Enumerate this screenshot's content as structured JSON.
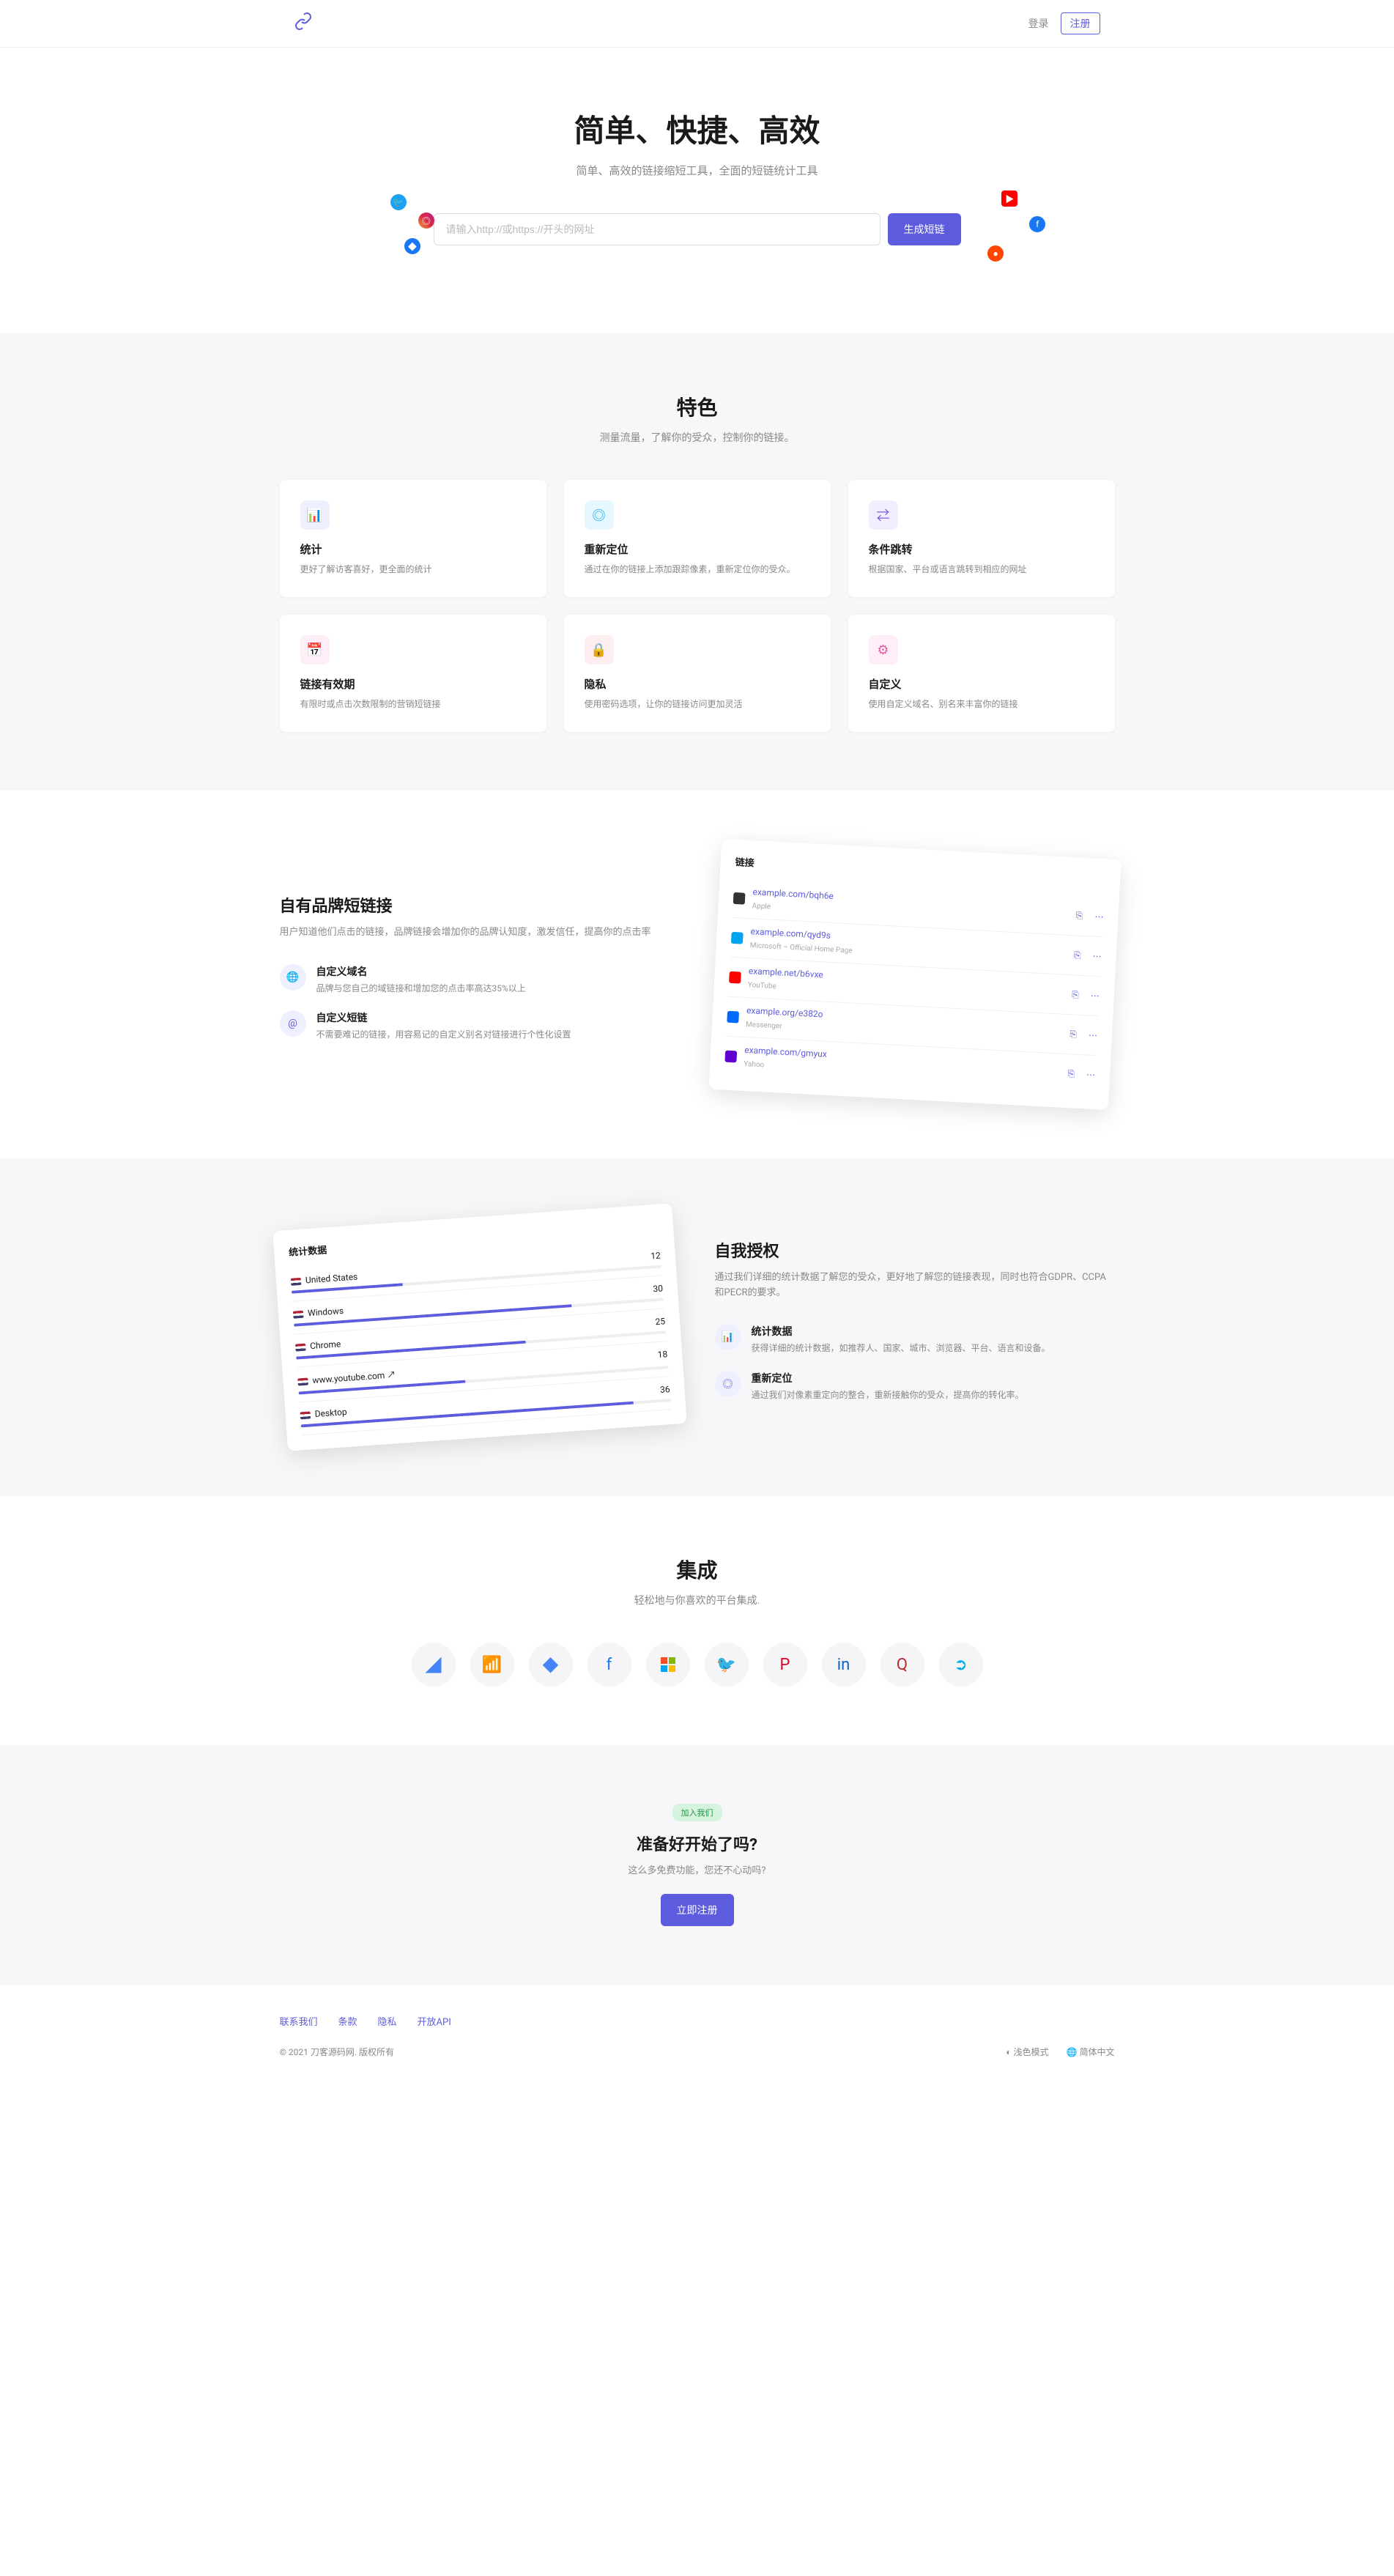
{
  "nav": {
    "login": "登录",
    "register": "注册"
  },
  "hero": {
    "title": "简单、快捷、高效",
    "subtitle": "简单、高效的链接缩短工具，全面的短链统计工具",
    "placeholder": "请输入http://或https://开头的网址",
    "button": "生成短链"
  },
  "features": {
    "title": "特色",
    "subtitle": "测量流量，了解你的受众，控制你的链接。",
    "items": [
      {
        "title": "统计",
        "desc": "更好了解访客喜好，更全面的统计"
      },
      {
        "title": "重新定位",
        "desc": "通过在你的链接上添加跟踪像素，重新定位你的受众。"
      },
      {
        "title": "条件跳转",
        "desc": "根据国家、平台或语言跳转到相应的网址"
      },
      {
        "title": "链接有效期",
        "desc": "有限时或点击次数限制的营销短链接"
      },
      {
        "title": "隐私",
        "desc": "使用密码选项，让你的链接访问更加灵活"
      },
      {
        "title": "自定义",
        "desc": "使用自定义域名、别名来丰富你的链接"
      }
    ]
  },
  "brand": {
    "title": "自有品牌短链接",
    "desc": "用户知道他们点击的链接，品牌链接会增加你的品牌认知度，激发信任，提高你的点击率",
    "items": [
      {
        "title": "自定义域名",
        "desc": "品牌与您自己的域链接和增加您的点击率高达35%以上"
      },
      {
        "title": "自定义短链",
        "desc": "不需要难记的链接，用容易记的自定义别名对链接进行个性化设置"
      }
    ],
    "mock": {
      "head": "链接",
      "rows": [
        {
          "link": "example.com/bqh6e",
          "sub": "Apple",
          "color": "#333"
        },
        {
          "link": "example.com/qyd9s",
          "sub": "Microsoft – Official Home Page",
          "color": "#00A4EF"
        },
        {
          "link": "example.net/b6vxe",
          "sub": "YouTube",
          "color": "#FF0000"
        },
        {
          "link": "example.org/e382o",
          "sub": "Messenger",
          "color": "#006AFF"
        },
        {
          "link": "example.com/gmyux",
          "sub": "Yahoo",
          "color": "#6001D2"
        }
      ]
    }
  },
  "empower": {
    "title": "自我授权",
    "desc": "通过我们详细的统计数据了解您的受众，更好地了解您的链接表现，同时也符合GDPR、CCPA和PECR的要求。",
    "items": [
      {
        "title": "统计数据",
        "desc": "获得详细的统计数据，如推荐人、国家、城市、浏览器、平台、语言和设备。"
      },
      {
        "title": "重新定位",
        "desc": "通过我们对像素重定向的整合，重新接触你的受众，提高你的转化率。"
      }
    ],
    "mock": {
      "head": "统计数据",
      "rows": [
        {
          "label": "United States",
          "value": "12",
          "pct": 30
        },
        {
          "label": "Windows",
          "value": "30",
          "pct": 75
        },
        {
          "label": "Chrome",
          "value": "25",
          "pct": 62
        },
        {
          "label": "www.youtube.com",
          "value": "18",
          "pct": 45,
          "ext": true
        },
        {
          "label": "Desktop",
          "value": "36",
          "pct": 90
        }
      ]
    }
  },
  "integrations": {
    "title": "集成",
    "subtitle": "轻松地与你喜欢的平台集成."
  },
  "cta": {
    "badge": "加入我们",
    "title": "准备好开始了吗?",
    "desc": "这么多免费功能，您还不心动吗?",
    "button": "立即注册"
  },
  "footer": {
    "links": [
      "联系我们",
      "条款",
      "隐私",
      "开放API"
    ],
    "copyright": "© 2021 刀客源码网. 版权所有",
    "theme": "浅色模式",
    "lang": "简体中文"
  }
}
